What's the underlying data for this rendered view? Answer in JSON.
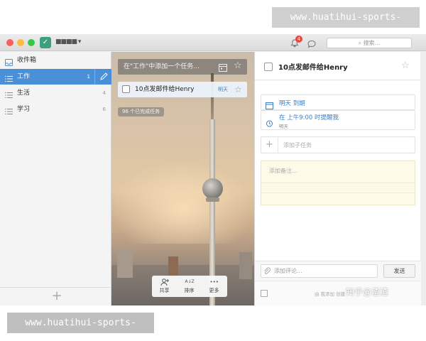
{
  "watermark": {
    "top": "www.huatihui-sports-zone.com",
    "bottom": "www.huatihui-sports-zone.com"
  },
  "titlebar": {
    "user_name": "■■■■ ▾",
    "notification_count": "4",
    "search_placeholder": "搜索..."
  },
  "sidebar": {
    "items": [
      {
        "label": "收件箱",
        "count": ""
      },
      {
        "label": "工作",
        "count": "1"
      },
      {
        "label": "生活",
        "count": "4"
      },
      {
        "label": "学习",
        "count": "6"
      }
    ],
    "add_label": "+"
  },
  "tasks": {
    "add_placeholder": "在\"工作\"中添加一个任务...",
    "items": [
      {
        "title": "10点发邮件给Henry",
        "due": "明天"
      }
    ],
    "completed_label": "96 个已完成任务"
  },
  "toolbar": {
    "share": "共享",
    "sort": "排序",
    "more": "更多",
    "sort_icon": "A↓Z",
    "more_icon": "•••"
  },
  "detail": {
    "title": "10点发邮件给Henry",
    "due": "明天 到期",
    "reminder": "在 上午9:00 时提醒我",
    "reminder_sub": "明天",
    "add_subtask": "添加子任务",
    "note_placeholder": "添加备注...",
    "comment_placeholder": "添加评论...",
    "send": "发送",
    "footer_meta": "由 我添加 创建",
    "footer_watermark": "知乎@渣渣"
  },
  "colors": {
    "accent": "#4a90d9",
    "due_blue": "#3c7fc4",
    "note_bg": "#fdfbe8"
  }
}
